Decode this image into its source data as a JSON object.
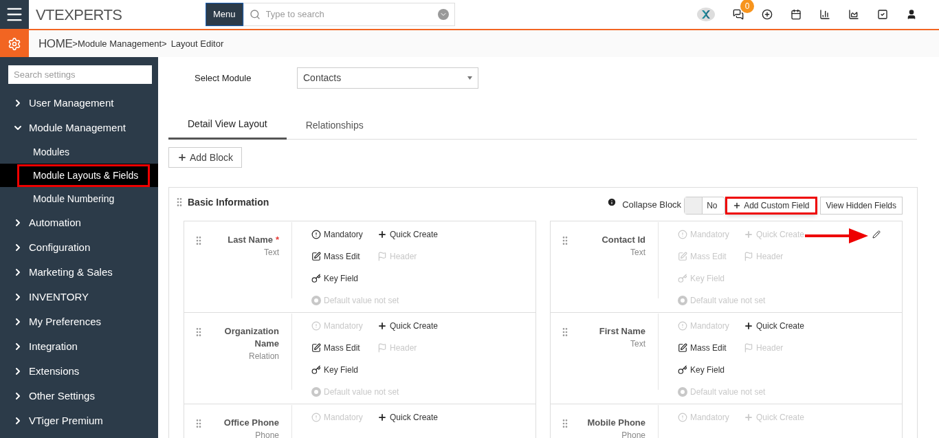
{
  "topbar": {
    "logo": "VTEXPERTS",
    "menu_button": "Menu",
    "search": {
      "placeholder": "Type to search"
    },
    "notification_count": "0"
  },
  "breadcrumb": {
    "home": "HOME",
    "items": [
      ">Module Management",
      ">",
      "Layout Editor"
    ]
  },
  "sidebar": {
    "search": {
      "placeholder": "Search settings"
    },
    "items": [
      {
        "label": "User Management",
        "expanded": false
      },
      {
        "label": "Module Management",
        "expanded": true,
        "children": [
          {
            "label": "Modules",
            "selected": false,
            "highlighted": false
          },
          {
            "label": "Module Layouts & Fields",
            "selected": true,
            "highlighted": true
          },
          {
            "label": "Module Numbering",
            "selected": false,
            "highlighted": false
          }
        ]
      },
      {
        "label": "Automation",
        "expanded": false
      },
      {
        "label": "Configuration",
        "expanded": false
      },
      {
        "label": "Marketing & Sales",
        "expanded": false
      },
      {
        "label": "INVENTORY",
        "expanded": false
      },
      {
        "label": "My Preferences",
        "expanded": false
      },
      {
        "label": "Integration",
        "expanded": false
      },
      {
        "label": "Extensions",
        "expanded": false
      },
      {
        "label": "Other Settings",
        "expanded": false
      },
      {
        "label": "VTiger Premium",
        "expanded": false
      }
    ]
  },
  "select_module": {
    "label": "Select Module",
    "value": "Contacts"
  },
  "tabs": [
    {
      "label": "Detail View Layout",
      "selected": true
    },
    {
      "label": "Relationships",
      "selected": false
    }
  ],
  "add_block_button": "Add Block",
  "block": {
    "title": "Basic Information",
    "collapse_label": "Collapse Block",
    "collapse_toggle": {
      "label": "No",
      "on": false
    },
    "buttons": [
      {
        "label": "Add Custom Field",
        "kind": "add",
        "highlighted": true
      },
      {
        "label": "View Hidden Fields",
        "kind": "plain",
        "highlighted": false
      }
    ],
    "fields": [
      {
        "name": "Last Name",
        "required_mark": "*",
        "type": "Text",
        "edit_icon": false,
        "options": [
          {
            "kind": "mandatory",
            "label": "Mandatory",
            "on": true
          },
          {
            "kind": "quick_create",
            "label": "Quick Create",
            "on": true
          },
          {
            "kind": "mass_edit",
            "label": "Mass Edit",
            "on": true
          },
          {
            "kind": "header",
            "label": "Header",
            "on": false
          },
          {
            "kind": "key_field",
            "label": "Key Field",
            "on": true
          },
          {
            "kind": "default",
            "label": "Default value not set",
            "on": false
          }
        ]
      },
      {
        "name": "Contact Id",
        "type": "Text",
        "edit_icon": true,
        "options": [
          {
            "kind": "mandatory",
            "label": "Mandatory",
            "on": false
          },
          {
            "kind": "quick_create",
            "label": "Quick Create",
            "on": false
          },
          {
            "kind": "mass_edit",
            "label": "Mass Edit",
            "on": false
          },
          {
            "kind": "header",
            "label": "Header",
            "on": false
          },
          {
            "kind": "key_field",
            "label": "Key Field",
            "on": false
          },
          {
            "kind": "default",
            "label": "Default value not set",
            "on": false
          }
        ]
      },
      {
        "name": "Organization Name",
        "type": "Relation",
        "edit_icon": false,
        "options": [
          {
            "kind": "mandatory",
            "label": "Mandatory",
            "on": false
          },
          {
            "kind": "quick_create",
            "label": "Quick Create",
            "on": true
          },
          {
            "kind": "mass_edit",
            "label": "Mass Edit",
            "on": true
          },
          {
            "kind": "header",
            "label": "Header",
            "on": false
          },
          {
            "kind": "key_field",
            "label": "Key Field",
            "on": true
          },
          {
            "kind": "default",
            "label": "Default value not set",
            "on": false
          }
        ]
      },
      {
        "name": "First Name",
        "type": "Text",
        "edit_icon": false,
        "options": [
          {
            "kind": "mandatory",
            "label": "Mandatory",
            "on": false
          },
          {
            "kind": "quick_create",
            "label": "Quick Create",
            "on": true
          },
          {
            "kind": "mass_edit",
            "label": "Mass Edit",
            "on": true
          },
          {
            "kind": "header",
            "label": "Header",
            "on": false
          },
          {
            "kind": "key_field",
            "label": "Key Field",
            "on": true
          },
          {
            "kind": "default",
            "label": "Default value not set",
            "on": false
          }
        ]
      },
      {
        "name": "Office Phone",
        "type": "Phone",
        "edit_icon": false,
        "options": [
          {
            "kind": "mandatory",
            "label": "Mandatory",
            "on": false
          },
          {
            "kind": "quick_create",
            "label": "Quick Create",
            "on": true
          }
        ]
      },
      {
        "name": "Mobile Phone",
        "type": "Phone",
        "edit_icon": false,
        "options": [
          {
            "kind": "mandatory",
            "label": "Mandatory",
            "on": false
          },
          {
            "kind": "quick_create",
            "label": "Quick Create",
            "on": false
          }
        ]
      }
    ]
  }
}
